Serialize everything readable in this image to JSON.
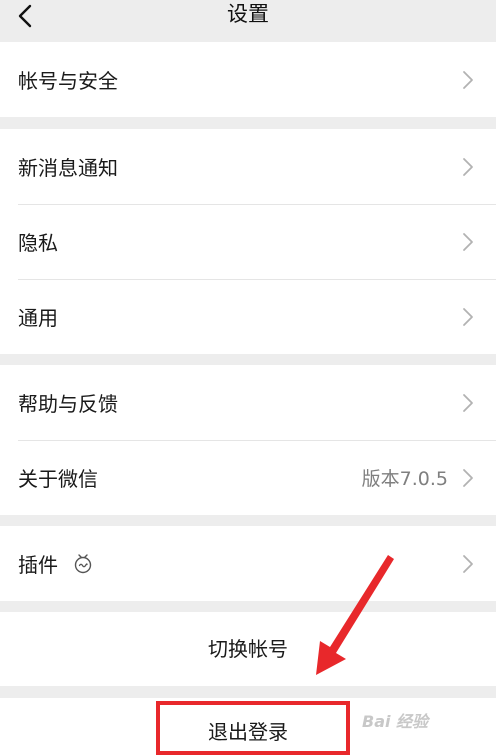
{
  "nav": {
    "title": "设置"
  },
  "groups": {
    "account": {
      "label": "帐号与安全"
    },
    "notify": {
      "label": "新消息通知"
    },
    "privacy": {
      "label": "隐私"
    },
    "general": {
      "label": "通用"
    },
    "help": {
      "label": "帮助与反馈"
    },
    "about": {
      "label": "关于微信",
      "value": "版本7.0.5"
    },
    "plugins": {
      "label": "插件"
    }
  },
  "actions": {
    "switch_account": "切换帐号",
    "logout": "退出登录"
  },
  "watermark": {
    "text": "Bai 经验"
  },
  "colors": {
    "background": "#ededed",
    "card": "#ffffff",
    "annotation": "#e8282b",
    "secondary_text": "#7f7f7f"
  }
}
